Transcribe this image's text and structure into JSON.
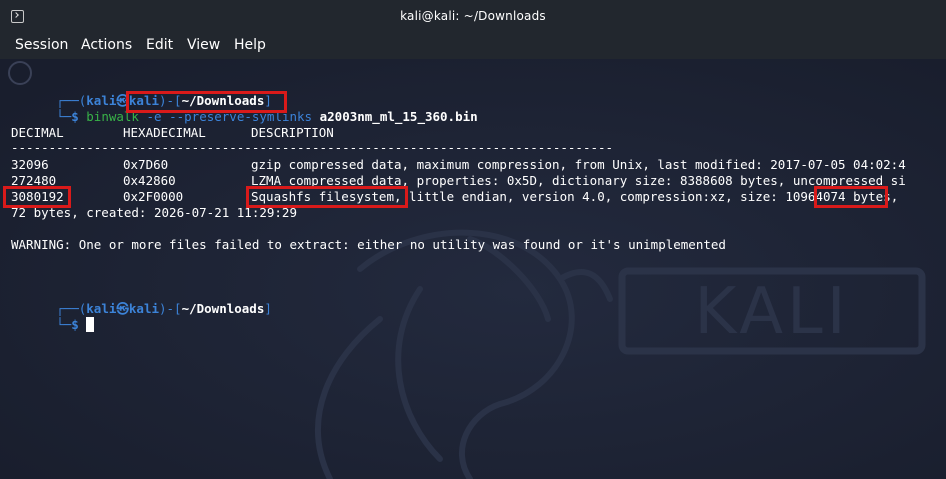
{
  "window": {
    "title": "kali@kali: ~/Downloads"
  },
  "menu": {
    "items": [
      "Session",
      "Actions",
      "Edit",
      "View",
      "Help"
    ]
  },
  "prompt": {
    "open": "┌──(",
    "user": "kali",
    "at": "㉿",
    "host": "kali",
    "mid": ")-[",
    "path": "~/Downloads",
    "close": "]",
    "second_prefix": "└─",
    "dollar": "$"
  },
  "command": {
    "program": "binwalk",
    "flag_e": "-e",
    "flag_symlinks": "--preserve-symlinks",
    "argument": "a2003nm_ml_15_360.bin"
  },
  "table": {
    "headers": [
      "DECIMAL",
      "HEXADECIMAL",
      "DESCRIPTION"
    ],
    "separator": "--------------------------------------------------------------------------------",
    "rows": [
      {
        "decimal": "32096",
        "hex": "0x7D60",
        "description": "gzip compressed data, maximum compression, from Unix, last modified: 2017-07-05 04:02:4"
      },
      {
        "decimal": "272480",
        "hex": "0x42860",
        "description": "LZMA compressed data, properties: 0x5D, dictionary size: 8388608 bytes, uncompressed si"
      },
      {
        "decimal": "3080192",
        "hex": "0x2F0000",
        "desc_highlight": "Squashfs filesystem",
        "desc_middle": ", little endian, version 4.0, compression:xz, size: ",
        "desc_size": "10964074",
        "desc_tail": " bytes,"
      }
    ],
    "wrap_line": "72 bytes, created: 2026-07-21 11:29:29"
  },
  "warning": "WARNING: One or more files failed to extract: either no utility was found or it's unimplemented",
  "wallpaper": {
    "logo_text": "KALI"
  },
  "colors": {
    "background": "#1c2234",
    "prompt_blue": "#3c83d8",
    "command_green": "#38b248",
    "highlight_red": "#d91a1a"
  }
}
